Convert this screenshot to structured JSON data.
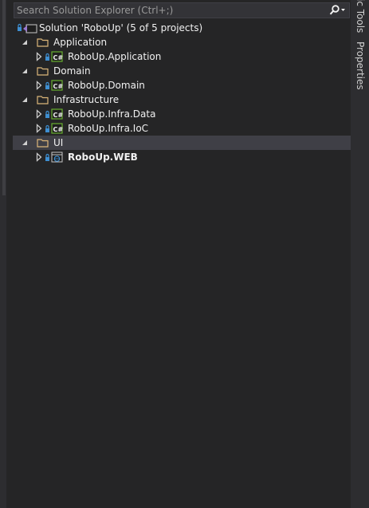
{
  "search": {
    "placeholder": "Search Solution Explorer (Ctrl+;)"
  },
  "solution": {
    "label": "Solution 'RoboUp' (5 of 5 projects)"
  },
  "folders": [
    {
      "label": "Application",
      "projects": [
        {
          "label": "RoboUp.Application",
          "icon": "csharp-project-icon"
        }
      ]
    },
    {
      "label": "Domain",
      "projects": [
        {
          "label": "RoboUp.Domain",
          "icon": "csharp-project-icon"
        }
      ]
    },
    {
      "label": "Infrastructure",
      "projects": [
        {
          "label": "RoboUp.Infra.Data",
          "icon": "csharp-project-icon"
        },
        {
          "label": "RoboUp.Infra.IoC",
          "icon": "csharp-project-icon"
        }
      ]
    },
    {
      "label": "UI",
      "selected": true,
      "projects": [
        {
          "label": "RoboUp.WEB",
          "icon": "web-project-icon",
          "bold": true
        }
      ]
    }
  ],
  "side_tabs": [
    "ic Tools",
    "Properties"
  ],
  "colors": {
    "background": "#1e1e1e",
    "panel": "#252526",
    "selection": "#3f3f46",
    "folder": "#dcb67a",
    "csharp": "#68b030",
    "lock": "#3e8ed0",
    "solution": "#9b7ad3"
  }
}
